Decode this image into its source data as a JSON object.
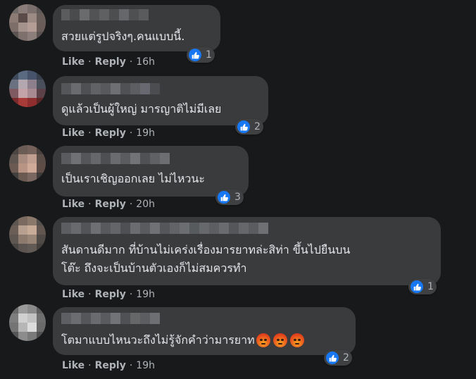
{
  "labels": {
    "like": "Like",
    "reply": "Reply",
    "sep": "·"
  },
  "comments": [
    {
      "text": "สวยแต่รูปจริงๆ.คนแบบนี้.",
      "time": "16h",
      "reaction_count": "1",
      "reactions": [
        "like-icon"
      ]
    },
    {
      "text": "ดูแล้วเป็นผู้ใหญ่ มารญาติไม่มีเลย",
      "time": "19h",
      "reaction_count": "2",
      "reactions": [
        "like-icon"
      ]
    },
    {
      "text": "เป็นเราเชิญออกเลย ไม่ไหวนะ",
      "time": "20h",
      "reaction_count": "3",
      "reactions": [
        "like-icon"
      ]
    },
    {
      "text": "สันดานดีมาก ที่บ้านไม่เคร่งเรื่องมารยาทล่ะสิท่า ขึ้นไปยืนบน\nโต๊ะ ถึงจะเป็นบ้านตัวเองก็ไม่สมควรทำ",
      "time": "19h",
      "reaction_count": "1",
      "reactions": [
        "like-icon"
      ]
    },
    {
      "text": "โตมาแบบไหนวะถึงไม่รู้จักคำว่ามารยาท",
      "time": "19h",
      "reaction_count": "2",
      "reactions": [
        "like-icon"
      ],
      "emojis": [
        "angry-face-icon",
        "angry-face-icon",
        "angry-face-icon"
      ]
    }
  ],
  "colors": {
    "background": "#18191a",
    "bubble": "#3a3b3c",
    "text": "#e4e6eb",
    "muted": "#b0b3b8",
    "like_blue": "#1877f2"
  }
}
